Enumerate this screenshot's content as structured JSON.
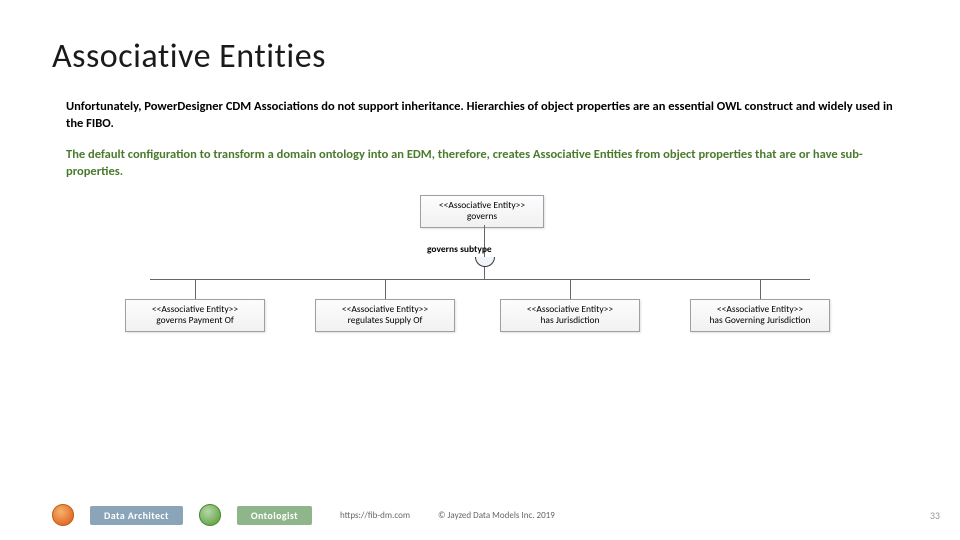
{
  "title": "Associative Entities",
  "paragraphs": {
    "p1": "Unfortunately, PowerDesigner CDM Associations do not support inheritance. Hierarchies of object properties are an essential OWL construct and widely used in the FIBO.",
    "p2": "The default configuration to transform a domain ontology into an EDM, therefore, creates Associative Entities from object properties that are or have sub-properties."
  },
  "diagram": {
    "stereotype": "<<Associative Entity>>",
    "parent_name": "governs",
    "edge_label": "governs subtype",
    "children": [
      {
        "name": "governs Payment Of"
      },
      {
        "name": "regulates Supply Of"
      },
      {
        "name": "has Jurisdiction"
      },
      {
        "name": "has Governing Jurisdiction"
      }
    ]
  },
  "footer": {
    "role1": "Data Architect",
    "role2": "Ontologist",
    "url": "https://fib-dm.com",
    "copyright": "© Jayzed Data Models Inc. 2019",
    "page": "33"
  }
}
